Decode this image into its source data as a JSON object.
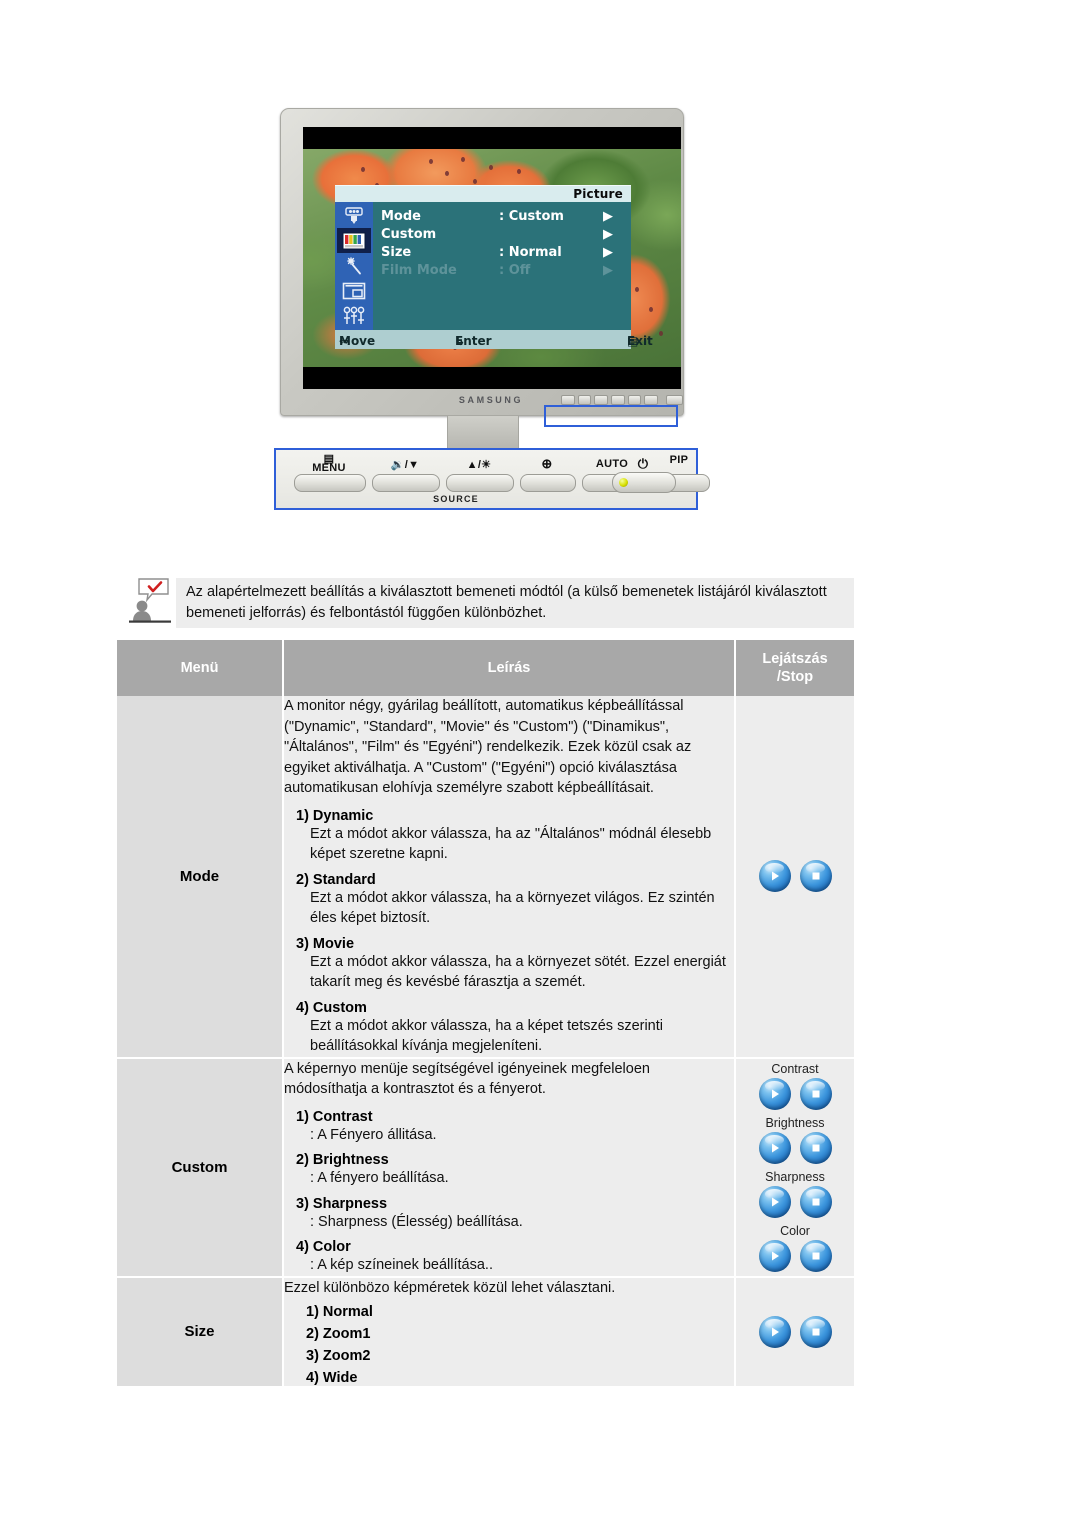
{
  "monitor": {
    "brand": "SAMSUNG",
    "osd": {
      "title": "Picture",
      "rows": [
        {
          "label": "Mode",
          "value": ": Custom",
          "arrow": "▶",
          "dim": false
        },
        {
          "label": "Custom",
          "value": "",
          "arrow": "▶",
          "dim": false
        },
        {
          "label": "Size",
          "value": ": Normal",
          "arrow": "▶",
          "dim": false
        },
        {
          "label": "Film Mode",
          "value": ": Off",
          "arrow": "▶",
          "dim": true
        }
      ],
      "footer": {
        "move": "Move",
        "enter": "Enter",
        "exit": "Exit"
      },
      "sidebar_icons": [
        "input-source-icon",
        "picture-color-bars-icon",
        "magic-wand-icon",
        "pip-window-icon",
        "setup-sliders-icon"
      ],
      "selected_sidebar_index": 1
    },
    "control_panel": {
      "buttons": [
        {
          "name": "menu-button",
          "label": "MENU"
        },
        {
          "name": "volume-down-button",
          "label": "🔉/▼"
        },
        {
          "name": "brightness-up-button",
          "label": "▲/☀"
        },
        {
          "name": "source-button",
          "label": "⊕"
        },
        {
          "name": "auto-button",
          "label": "AUTO"
        },
        {
          "name": "pip-button",
          "label": "PIP"
        }
      ],
      "source_label": "SOURCE",
      "power_label": "⏻"
    }
  },
  "note": {
    "icon": "note-person-checkmark-icon",
    "text": "Az alapértelmezett beállítás a kiválasztott bemeneti módtól (a külső bemenetek listájáról kiválasztott bemeneti jelforrás) és felbontástól függően különbözhet."
  },
  "table": {
    "headers": {
      "menu": "Menü",
      "description": "Leírás",
      "play_stop": "Lejátszás\n/Stop"
    },
    "header_play_line1": "Lejátszás",
    "header_play_line2": "/Stop",
    "rows": [
      {
        "menu": "Mode",
        "intro": "A monitor négy, gyárilag beállított, automatikus képbeállítással (\"Dynamic\", \"Standard\", \"Movie\" és \"Custom\") (\"Dinamikus\", \"Általános\", \"Film\" és \"Egyéni\") rendelkezik. Ezek közül csak az egyiket aktiválhatja. A \"Custom\" (\"Egyéni\") opció kiválasztása automatikusan elohívja személyre szabott képbeállításait.",
        "items": [
          {
            "title": "1) Dynamic",
            "body": "Ezt a módot akkor válassza, ha az \"Általános\" módnál élesebb képet szeretne kapni."
          },
          {
            "title": "2) Standard",
            "body": "Ezt a módot akkor válassza, ha a környezet világos. Ez szintén éles képet biztosít."
          },
          {
            "title": "3) Movie",
            "body": "Ezt a módot akkor válassza, ha a környezet sötét. Ezzel energiát takarít meg és kevésbé fárasztja a szemét."
          },
          {
            "title": "4) Custom",
            "body": "Ezt a módot akkor válassza, ha a képet tetszés szerinti beállításokkal kívánja megjeleníteni."
          }
        ],
        "buttons": [
          {
            "label": ""
          }
        ]
      },
      {
        "menu": "Custom",
        "intro": "A képernyo menüje segítségével igényeinek megfeleloen módosíthatja a kontrasztot és a fényerot.",
        "items": [
          {
            "title": "1) Contrast",
            "body": ": A Fényero állitása."
          },
          {
            "title": "2) Brightness",
            "body": ": A fényero beállítása."
          },
          {
            "title": "3) Sharpness",
            "body": ": Sharpness (Élesség) beállítása."
          },
          {
            "title": "4) Color",
            "body": ": A kép színeinek beállítása.."
          }
        ],
        "buttons": [
          {
            "label": "Contrast"
          },
          {
            "label": "Brightness"
          },
          {
            "label": "Sharpness"
          },
          {
            "label": "Color"
          }
        ]
      },
      {
        "menu": "Size",
        "intro": "Ezzel különbözo képméretek közül lehet választani.",
        "size_options": [
          "1) Normal",
          "2) Zoom1",
          "3) Zoom2",
          "4) Wide"
        ],
        "buttons": [
          {
            "label": ""
          }
        ]
      }
    ]
  },
  "colors": {
    "osd_body": "#2b7279",
    "osd_sidebar": "#2f63b5",
    "osd_selected": "#10204a",
    "osd_footer": "#aeced0",
    "osd_titlebar": "#d9ecee",
    "table_header": "#a8a8a8",
    "table_menu_col": "#dddddd",
    "table_desc_col": "#ededed",
    "highlight_border": "#2f5fd8",
    "orb_blue": "#3d96dd",
    "note_bg": "#ededed",
    "power_led": "#d8e000"
  }
}
